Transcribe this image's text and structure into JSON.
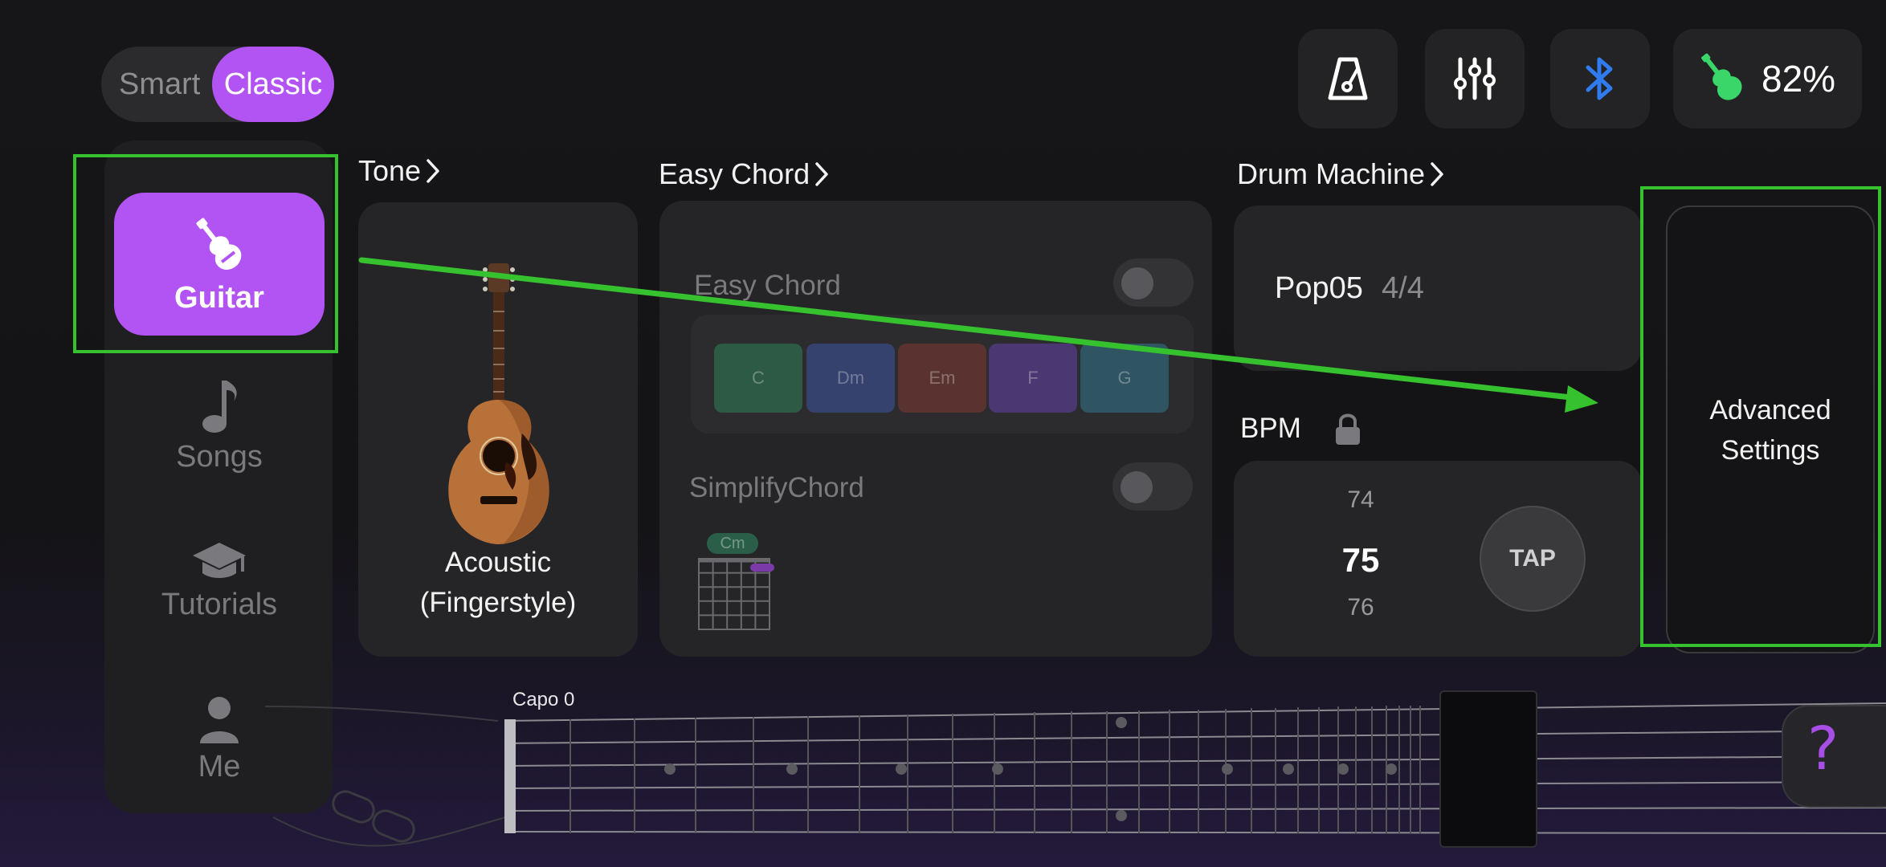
{
  "mode_toggle": {
    "smart_label": "Smart",
    "classic_label": "Classic",
    "selected": "Classic"
  },
  "toolbar": {
    "metronome_icon": "metronome-icon",
    "mixer_icon": "sliders-icon",
    "bluetooth_icon": "bluetooth-icon",
    "battery_icon": "guitar-battery-icon",
    "battery_text": "82%"
  },
  "sidebar": {
    "items": [
      {
        "label": "Guitar",
        "icon": "guitar-icon",
        "active": true
      },
      {
        "label": "Songs",
        "icon": "music-note-icon",
        "active": false
      },
      {
        "label": "Tutorials",
        "icon": "graduation-cap-icon",
        "active": false
      },
      {
        "label": "Me",
        "icon": "person-icon",
        "active": false
      }
    ]
  },
  "tone": {
    "title": "Tone",
    "name_line1": "Acoustic",
    "name_line2": "(Fingerstyle)"
  },
  "easy_chord": {
    "title": "Easy Chord",
    "toggle_label": "Easy Chord",
    "chords": [
      "C",
      "Dm",
      "Em",
      "F",
      "G"
    ],
    "simplify_label": "SimplifyChord",
    "diagram_chord": "Cm"
  },
  "drum_machine": {
    "title": "Drum Machine",
    "pattern": "Pop05",
    "time_signature": "4/4"
  },
  "bpm": {
    "label": "BPM",
    "prev": "74",
    "current": "75",
    "next": "76",
    "tap_label": "TAP"
  },
  "advanced": {
    "line1": "Advanced",
    "line2": "Settings"
  },
  "fretboard": {
    "capo_label": "Capo 0"
  },
  "colors": {
    "accent": "#b253f3",
    "highlight": "#35c22e",
    "bluetooth": "#2f7bf0",
    "battery_guitar": "#3ad66a"
  }
}
